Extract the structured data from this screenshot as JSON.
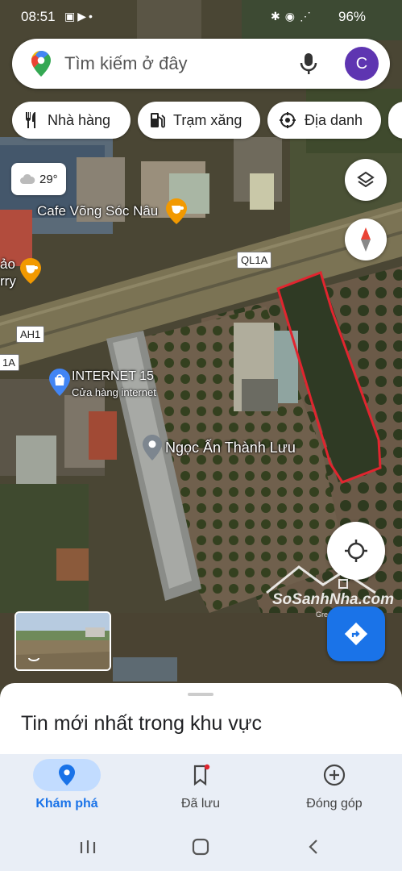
{
  "status": {
    "time": "08:51",
    "battery": "96%"
  },
  "search": {
    "placeholder": "Tìm kiếm ở đây",
    "avatar_letter": "C"
  },
  "chips": [
    {
      "label": "Nhà hàng",
      "icon": "restaurant-icon"
    },
    {
      "label": "Trạm xăng",
      "icon": "gas-station-icon"
    },
    {
      "label": "Địa danh",
      "icon": "landmark-icon"
    }
  ],
  "weather": {
    "temperature": "29°",
    "icon": "cloud-icon"
  },
  "map_labels": {
    "cafe": "Cafe Võng Sóc Nâu",
    "cafe2_line1": "ảo",
    "cafe2_line2": "rry",
    "road_ql1a": "QL1A",
    "road_ah1": "AH1",
    "road_ql1a_left": "1A",
    "internet_title": "INTERNET 15",
    "internet_subtitle": "Cửa hàng internet",
    "place": "Ngọc Ấn Thành Lưu"
  },
  "watermark": {
    "brand": "SoSanhNha.com",
    "tagline": "Great choice for you"
  },
  "sheet": {
    "heading": "Tin mới nhất trong khu vực"
  },
  "bottom_nav": [
    {
      "label": "Khám phá",
      "icon": "explore-pin-icon",
      "active": true
    },
    {
      "label": "Đã lưu",
      "icon": "bookmark-icon",
      "active": false
    },
    {
      "label": "Đóng góp",
      "icon": "add-circle-icon",
      "active": false
    }
  ],
  "colors": {
    "accent": "#1a73e8",
    "active_pill": "#c2dcff",
    "highlight_outline": "#e0252f",
    "avatar": "#5e35b1"
  }
}
